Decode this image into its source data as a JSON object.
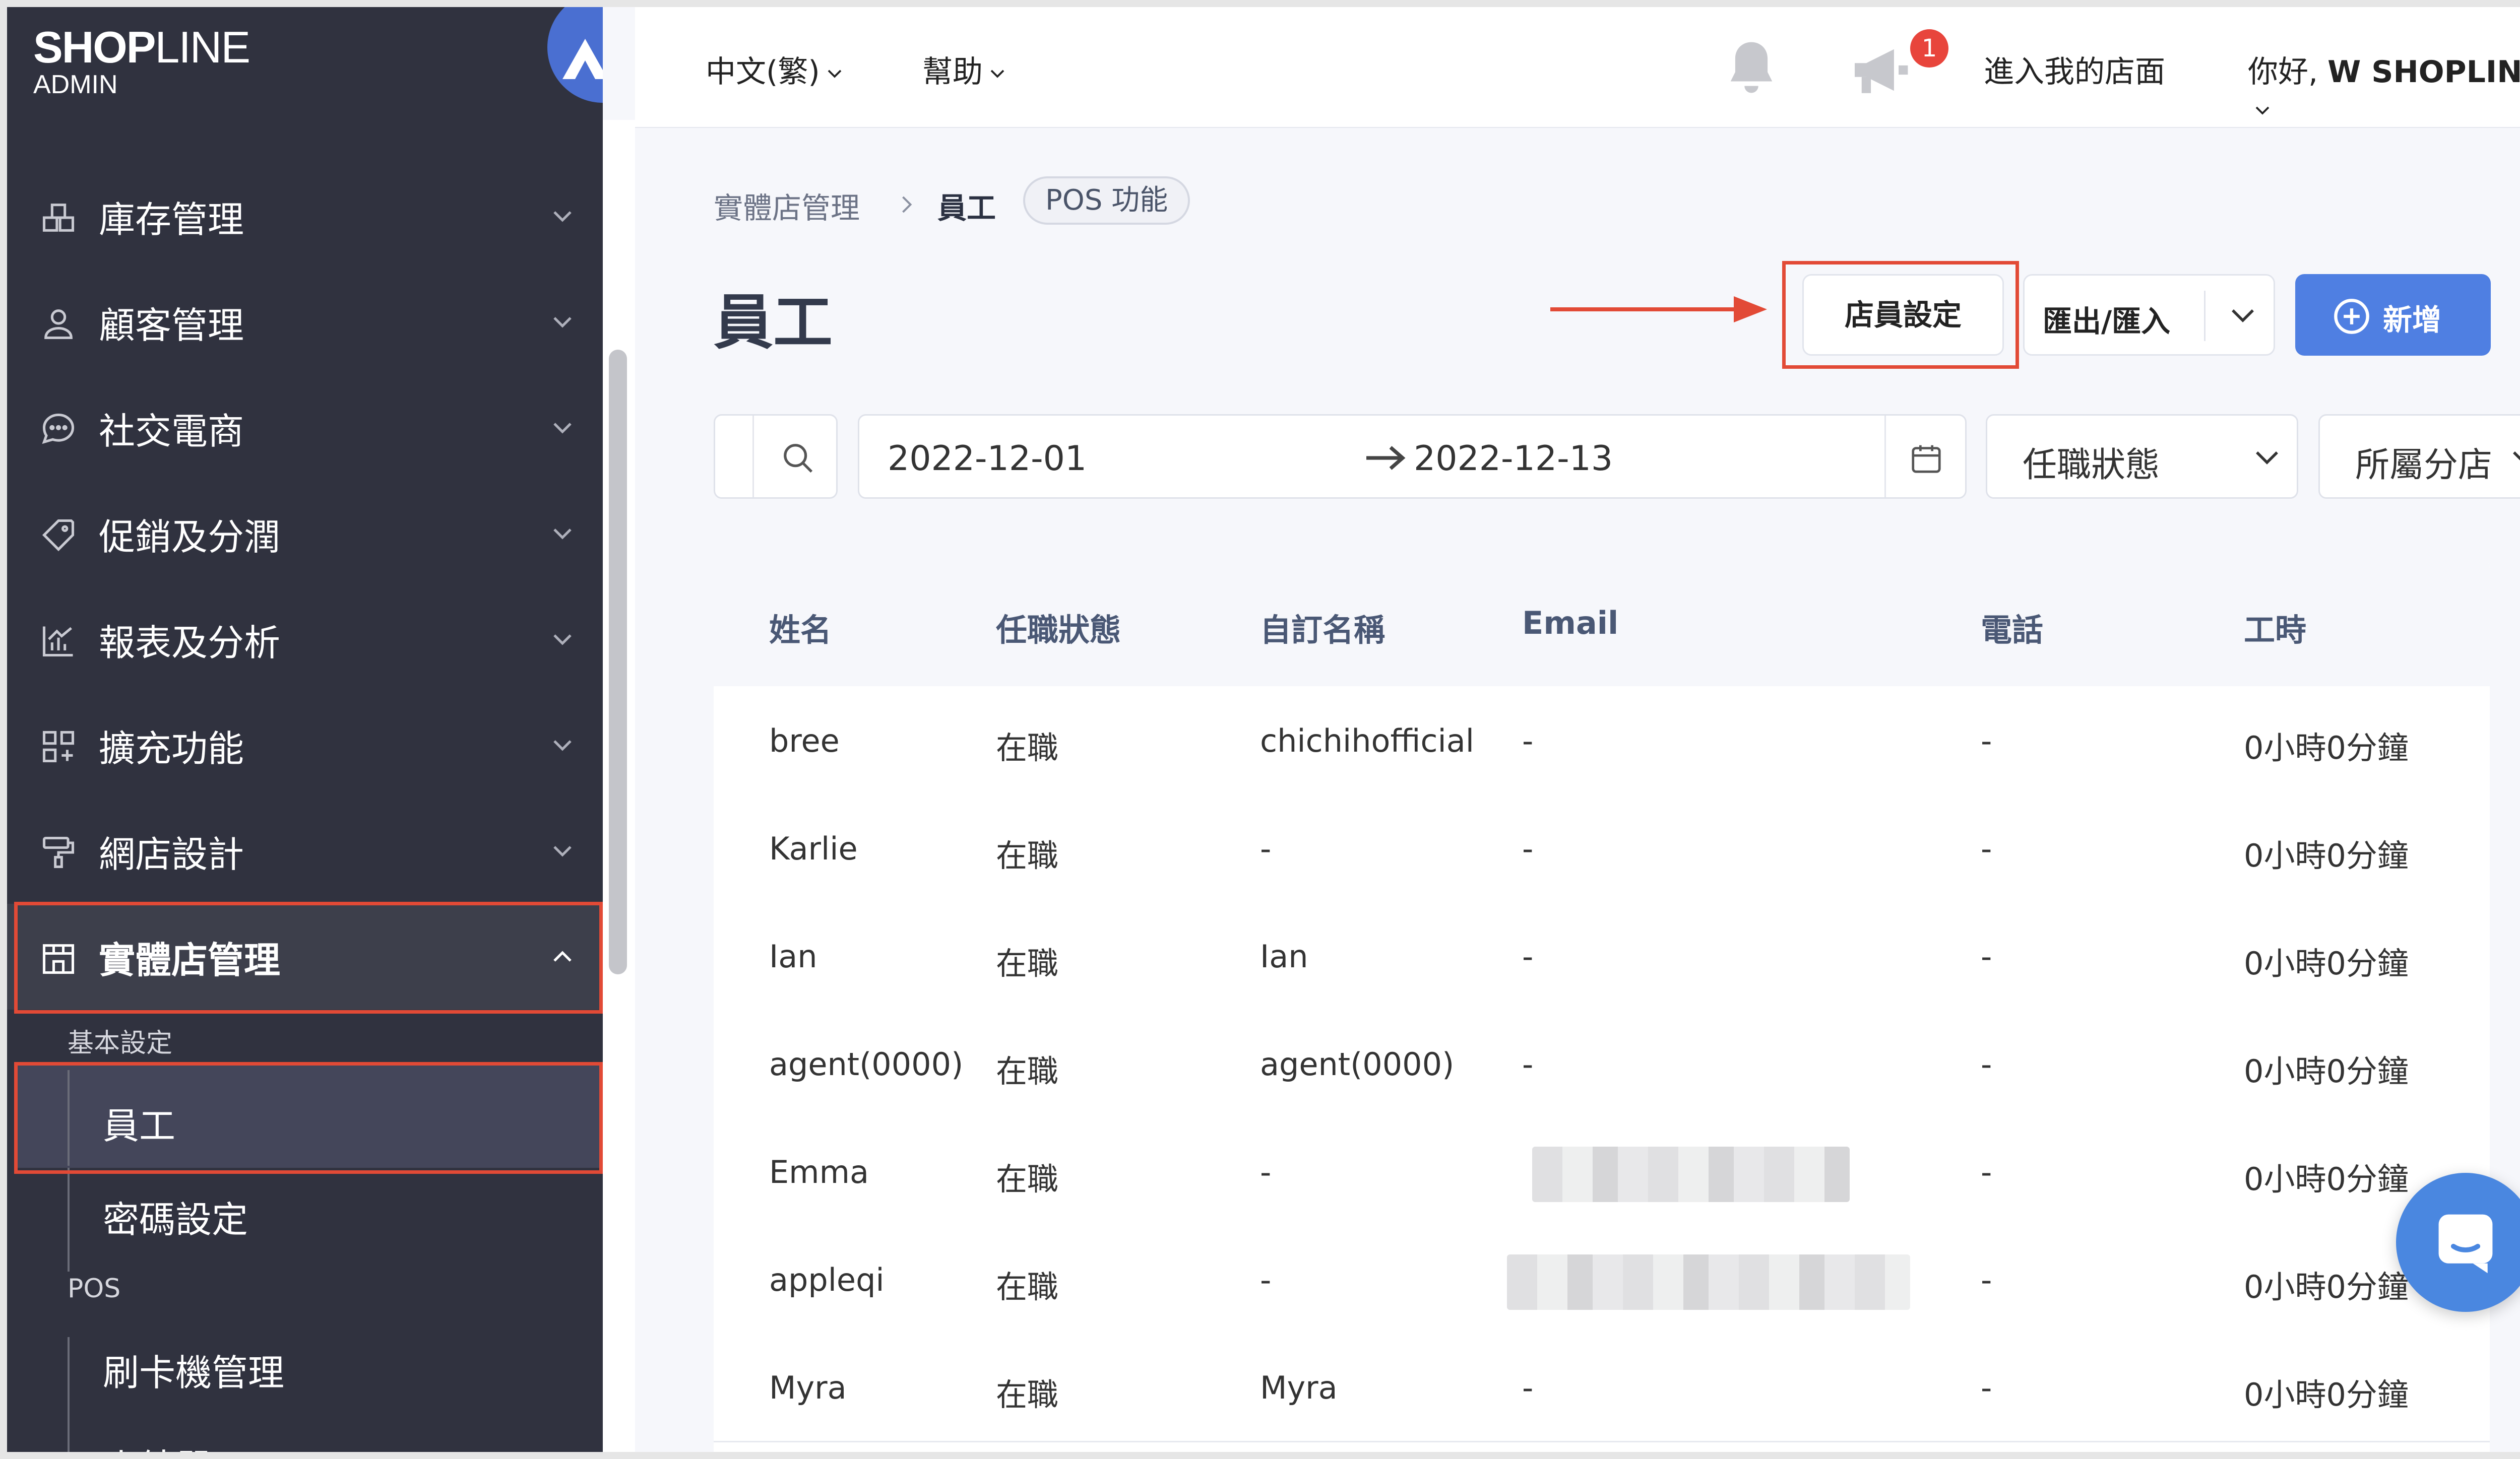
{
  "brand": {
    "logo_bold": "SHOP",
    "logo_thin": "LINE",
    "logo_sub": "ADMIN"
  },
  "topbar": {
    "language": "中文(繁)",
    "help": "幫助",
    "notification_count": "1",
    "store_link": "進入我的店面",
    "greeting": "你好,",
    "user_name": "W SHOPLINE"
  },
  "sidebar": {
    "items": [
      {
        "label": "庫存管理",
        "icon": "warehouse-icon"
      },
      {
        "label": "顧客管理",
        "icon": "user-icon"
      },
      {
        "label": "社交電商",
        "icon": "chat-bubble-icon"
      },
      {
        "label": "促銷及分潤",
        "icon": "tag-icon"
      },
      {
        "label": "報表及分析",
        "icon": "bar-chart-icon"
      },
      {
        "label": "擴充功能",
        "icon": "apps-grid-icon"
      },
      {
        "label": "網店設計",
        "icon": "paint-roller-icon"
      },
      {
        "label": "實體店管理",
        "icon": "storefront-icon"
      }
    ],
    "sub_heading_basic": "基本設定",
    "sub_items_basic": [
      "員工",
      "密碼設定"
    ],
    "sub_heading_pos": "POS",
    "sub_items_pos": [
      "刷卡機管理",
      "小結單"
    ]
  },
  "breadcrumb": {
    "parent": "實體店管理",
    "current": "員工",
    "tag": "POS 功能"
  },
  "page": {
    "title": "員工"
  },
  "actions": {
    "staff_settings": "店員設定",
    "export_import": "匯出/匯入",
    "add_new": "新增"
  },
  "filters": {
    "date_start": "2022-12-01",
    "date_end": "2022-12-13",
    "status_select": "任職狀態",
    "store_select": "所屬分店"
  },
  "table": {
    "headers": [
      "姓名",
      "任職狀態",
      "自訂名稱",
      "Email",
      "電話",
      "工時"
    ],
    "rows": [
      {
        "name": "bree",
        "status": "在職",
        "custom_name": "chichihofficial",
        "email": "-",
        "phone": "-",
        "hours": "0小時0分鐘"
      },
      {
        "name": "Karlie",
        "status": "在職",
        "custom_name": "-",
        "email": "-",
        "phone": "-",
        "hours": "0小時0分鐘"
      },
      {
        "name": "Ian",
        "status": "在職",
        "custom_name": "Ian",
        "email": "-",
        "phone": "-",
        "hours": "0小時0分鐘"
      },
      {
        "name": "agent(0000)",
        "status": "在職",
        "custom_name": "agent(0000)",
        "email": "-",
        "phone": "-",
        "hours": "0小時0分鐘"
      },
      {
        "name": "Emma",
        "status": "在職",
        "custom_name": "-",
        "email": "",
        "phone": "-",
        "hours": "0小時0分鐘"
      },
      {
        "name": "appleqi",
        "status": "在職",
        "custom_name": "-",
        "email": "",
        "phone": "-",
        "hours": "0小時0分鐘"
      },
      {
        "name": "Myra",
        "status": "在職",
        "custom_name": "Myra",
        "email": "-",
        "phone": "-",
        "hours": "0小時0分鐘"
      }
    ]
  },
  "colors": {
    "sidebar_bg": "#30323f",
    "primary": "#4f7fe2",
    "highlight_red": "#e24a36",
    "badge_red": "#e8453c"
  }
}
